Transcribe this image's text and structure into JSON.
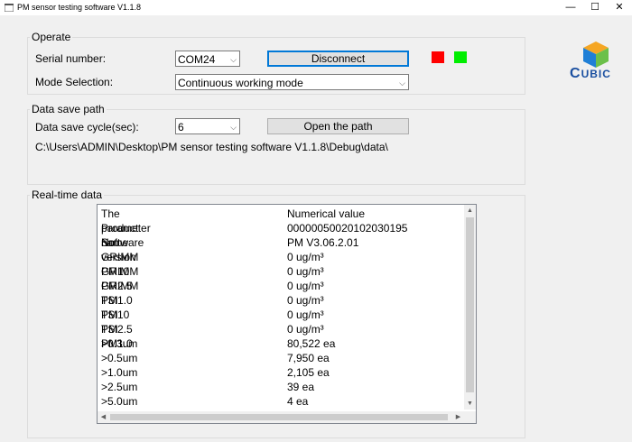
{
  "window": {
    "title": "PM sensor testing software V1.1.8",
    "minimize_glyph": "—",
    "maximize_glyph": "☐",
    "close_glyph": "✕"
  },
  "operate": {
    "group_label": "Operate",
    "serial_label": "Serial number:",
    "serial_value": "COM24",
    "disconnect_label": "Disconnect",
    "mode_label": "Mode Selection:",
    "mode_value": "Continuous working mode",
    "status_colors": [
      "#ff0000",
      "#00ee00"
    ]
  },
  "save": {
    "group_label": "Data save path",
    "cycle_label": "Data save cycle(sec):",
    "cycle_value": "6",
    "open_path_label": "Open the path",
    "path": "C:\\Users\\ADMIN\\Desktop\\PM sensor testing software V1.1.8\\Debug\\data\\"
  },
  "logo": {
    "text_big": "C",
    "text_rest": "UBIC",
    "colors": [
      "#1f7fd6",
      "#f5a623",
      "#6cc04a"
    ]
  },
  "realtime": {
    "group_label": "Real-time data",
    "headers": [
      "The parameter name",
      "Numerical value"
    ],
    "rows": [
      [
        "Product No.",
        "00000050020102030195"
      ],
      [
        "Software version",
        "PM V3.06.2.01"
      ],
      [
        "GRIMM PM10",
        "0 ug/m³"
      ],
      [
        "GRIMM PM2.5",
        "0 ug/m³"
      ],
      [
        "GRIMM PM1.0",
        "0 ug/m³"
      ],
      [
        "TSI PM10",
        "0 ug/m³"
      ],
      [
        "TSI PM2.5",
        "0 ug/m³"
      ],
      [
        "TSI PM1.0",
        "0 ug/m³"
      ],
      [
        ">0.3um",
        "80,522 ea"
      ],
      [
        ">0.5um",
        "7,950 ea"
      ],
      [
        ">1.0um",
        "2,105 ea"
      ],
      [
        ">2.5um",
        "39 ea"
      ],
      [
        ">5.0um",
        "4 ea"
      ]
    ]
  }
}
